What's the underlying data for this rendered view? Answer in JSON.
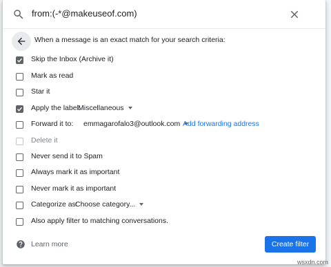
{
  "search": {
    "query": "from:(-*@makeuseof.com)"
  },
  "criteria_heading": "When a message is an exact match for your search criteria:",
  "options": [
    {
      "label": "Skip the Inbox (Archive it)",
      "checked": true
    },
    {
      "label": "Mark as read",
      "checked": false
    },
    {
      "label": "Star it",
      "checked": false
    },
    {
      "label": "Apply the label:",
      "checked": true,
      "select_value": "Miscellaneous"
    },
    {
      "label": "Forward it to:",
      "checked": false,
      "select_value": "emmagarofalo3@outlook.com",
      "link": "Add forwarding address"
    },
    {
      "label": "Delete it",
      "checked": false,
      "disabled": true
    },
    {
      "label": "Never send it to Spam",
      "checked": false
    },
    {
      "label": "Always mark it as important",
      "checked": false
    },
    {
      "label": "Never mark it as important",
      "checked": false
    },
    {
      "label": "Categorize as:",
      "checked": false,
      "select_value": "Choose category..."
    },
    {
      "label": "Also apply filter to matching conversations.",
      "checked": false
    }
  ],
  "footer": {
    "learn_more": "Learn more",
    "create_filter": "Create filter"
  },
  "watermark": "wsxdn.com",
  "colors": {
    "primary": "#1a73e8",
    "checkbox": "#5f6368"
  }
}
